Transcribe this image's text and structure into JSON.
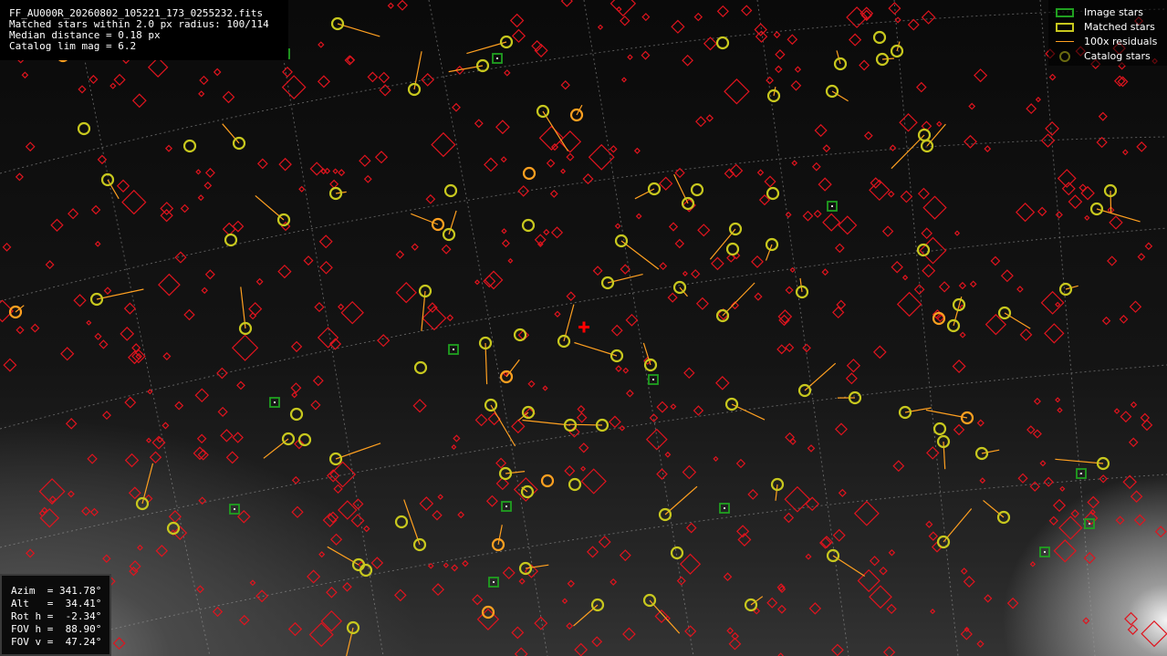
{
  "info": {
    "filename": "FF_AU000R_20260802_105221_173_0255232.fits",
    "matched": "Matched stars within 2.0 px radius: 100/114",
    "median": "Median distance = 0.18 px",
    "catalog_lim": "Catalog lim mag = 6.2"
  },
  "legend": {
    "image_stars": "Image stars",
    "matched_stars": "Matched stars",
    "residuals": "100x residuals",
    "catalog_stars": "Catalog stars"
  },
  "pointing": {
    "azim": "Azim  = 341.78°",
    "alt": "Alt   =  34.41°",
    "roth": "Rot h =  -2.34°",
    "fovh": "FOV h =  88.90°",
    "fovv": "FOV v =  47.24°"
  },
  "colors": {
    "catalog": "#e0141e",
    "matched": "#c8c81e",
    "residual": "#ffa020",
    "image": "#20a020",
    "grid": "#9a9a9a",
    "center": "#ff0000"
  }
}
